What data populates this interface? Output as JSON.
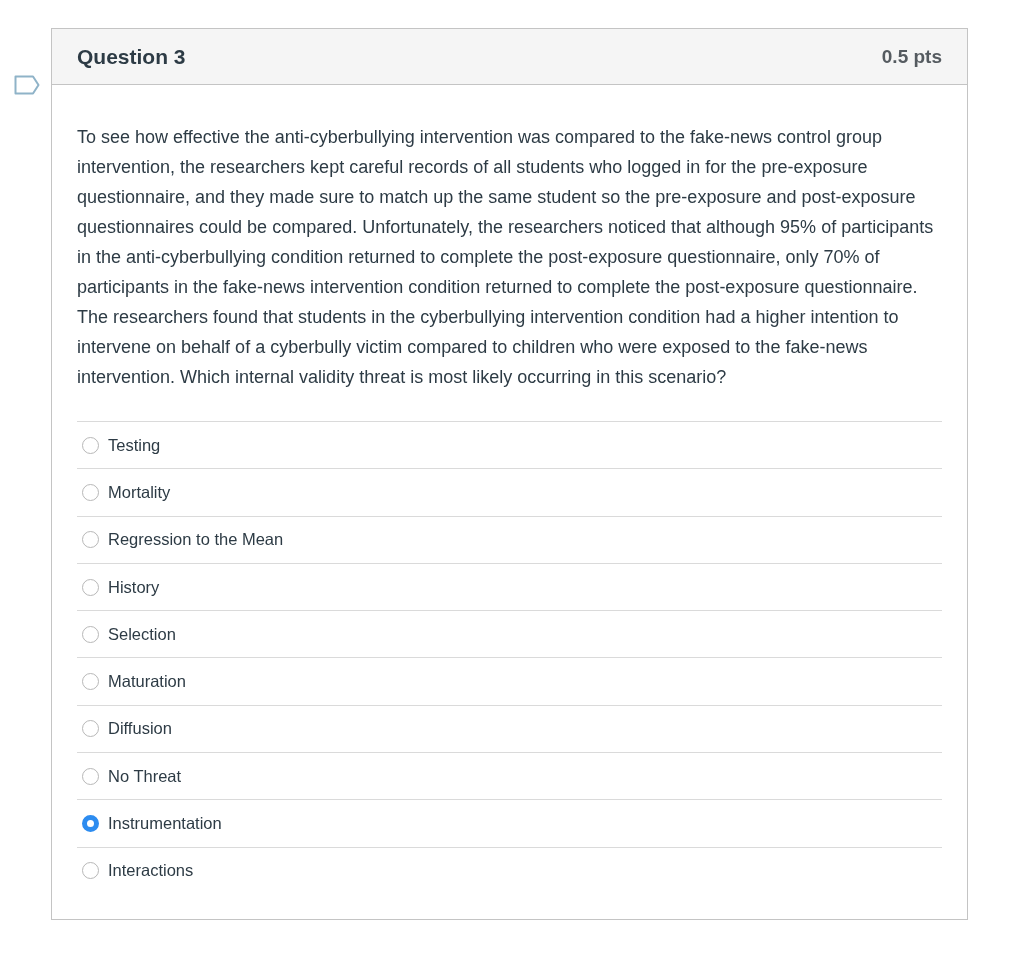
{
  "question": {
    "flagged": false,
    "title": "Question 3",
    "points": "0.5 pts",
    "text": "To see how effective the anti-cyberbullying intervention was compared to the fake-news control group intervention, the researchers kept careful records of all students who logged in for the pre-exposure questionnaire, and they made sure to match up the same student so the pre-exposure and post-exposure questionnaires could be compared. Unfortunately, the researchers noticed that although 95% of participants in the anti-cyberbullying condition returned to complete the post-exposure questionnaire, only 70% of participants in the fake-news intervention condition returned to complete the post-exposure questionnaire. The researchers found that students in the cyberbullying intervention condition had a higher intention to intervene on behalf of a cyberbully victim compared to children who were exposed to the fake-news intervention. Which internal validity threat is most likely occurring in this scenario?",
    "answers": [
      {
        "label": "Testing",
        "selected": false
      },
      {
        "label": "Mortality",
        "selected": false
      },
      {
        "label": "Regression to the Mean",
        "selected": false
      },
      {
        "label": "History",
        "selected": false
      },
      {
        "label": "Selection",
        "selected": false
      },
      {
        "label": "Maturation",
        "selected": false
      },
      {
        "label": "Diffusion",
        "selected": false
      },
      {
        "label": "No Threat",
        "selected": false
      },
      {
        "label": "Instrumentation",
        "selected": true
      },
      {
        "label": "Interactions",
        "selected": false
      }
    ]
  }
}
